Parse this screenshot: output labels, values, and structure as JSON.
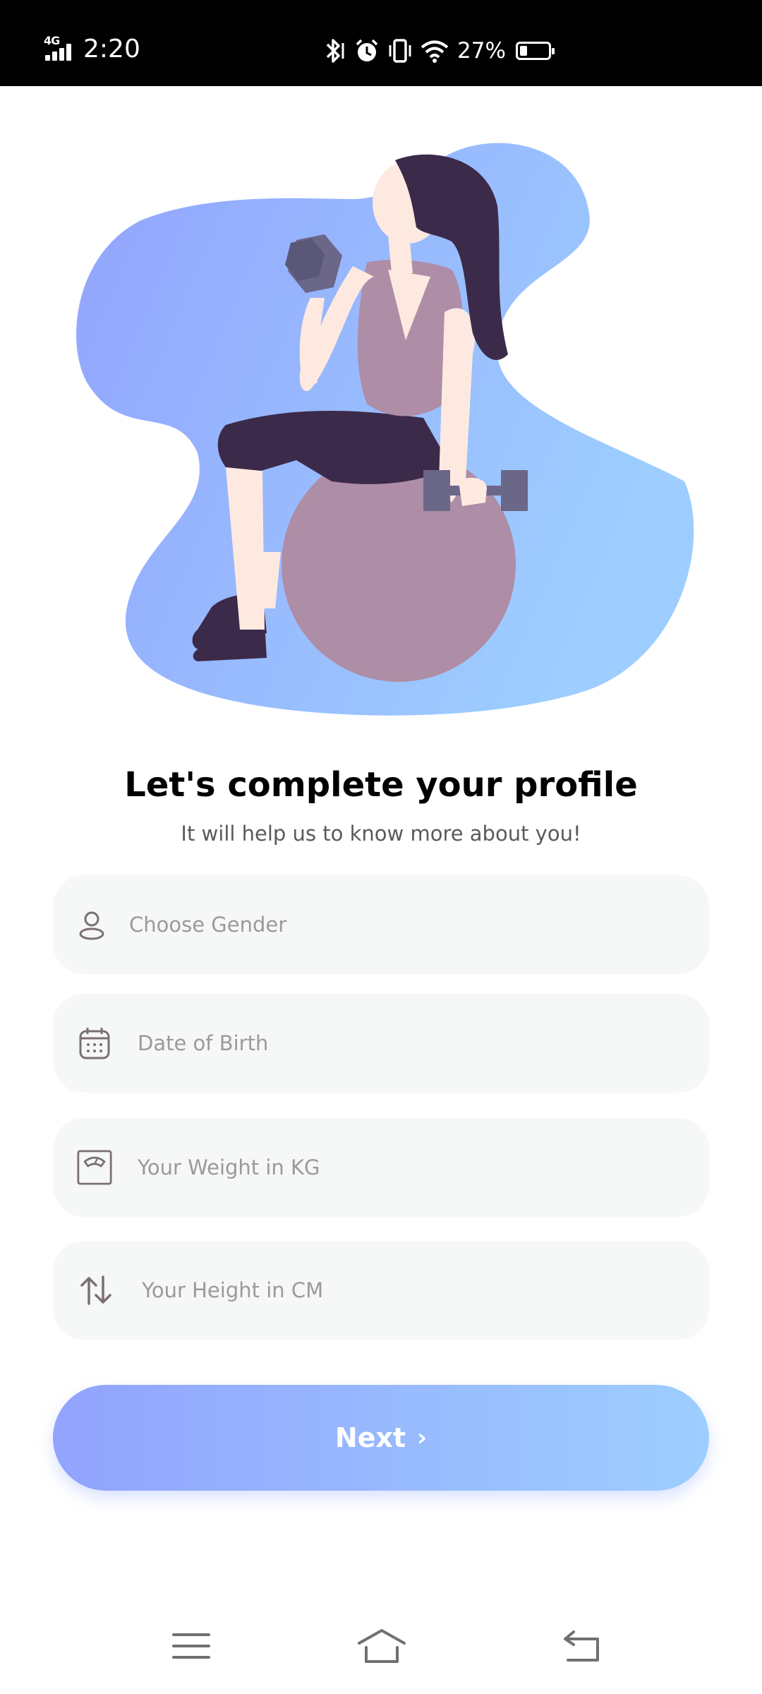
{
  "status_bar": {
    "network": "4G",
    "time": "2:20",
    "battery_percent": "27%",
    "battery_level": 0.27,
    "icons": [
      "bluetooth-icon",
      "alarm-icon",
      "vibrate-icon",
      "wifi-icon",
      "battery-icon"
    ]
  },
  "hero": {
    "illustration": "woman-exercising-on-ball-illustration"
  },
  "header": {
    "title": "Let's complete your profile",
    "subtitle": "It will help us to know more about you!"
  },
  "form": {
    "gender": {
      "placeholder": "Choose Gender",
      "icon": "user-icon"
    },
    "dob": {
      "placeholder": "Date of Birth",
      "icon": "calendar-icon"
    },
    "weight": {
      "placeholder": "Your Weight in KG",
      "icon": "scale-icon"
    },
    "height": {
      "placeholder": "Your Height in CM",
      "icon": "swap-vertical-icon"
    }
  },
  "next_button": {
    "label": "Next",
    "chevron": "›"
  },
  "nav_bar": {
    "icons": [
      "menu-icon",
      "home-icon",
      "back-icon"
    ]
  },
  "colors": {
    "gradient_start": "#92A3FD",
    "gradient_end": "#9DCEFF",
    "field_bg": "#F6F7F7",
    "placeholder": "#9A9A9A",
    "illustration_dark": "#3C2A4A",
    "illustration_mauve": "#AE8DA6"
  }
}
